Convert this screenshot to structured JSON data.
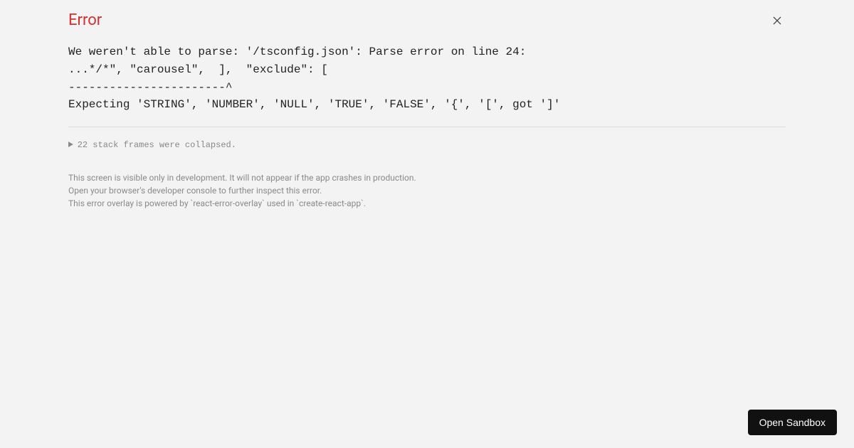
{
  "header": {
    "title": "Error"
  },
  "error": {
    "line1": "We weren't able to parse: '/tsconfig.json': Parse error on line 24:",
    "line2": "...*/*\", \"carousel\",  ],  \"exclude\": [",
    "line3": "-----------------------^",
    "line4": "Expecting 'STRING', 'NUMBER', 'NULL', 'TRUE', 'FALSE', '{', '[', got ']'"
  },
  "stack": {
    "summary": "22 stack frames were collapsed."
  },
  "notes": {
    "l1": "This screen is visible only in development. It will not appear if the app crashes in production.",
    "l2": "Open your browser's developer console to further inspect this error.",
    "l3": "This error overlay is powered by `react-error-overlay` used in `create-react-app`."
  },
  "actions": {
    "openSandbox": "Open Sandbox"
  }
}
